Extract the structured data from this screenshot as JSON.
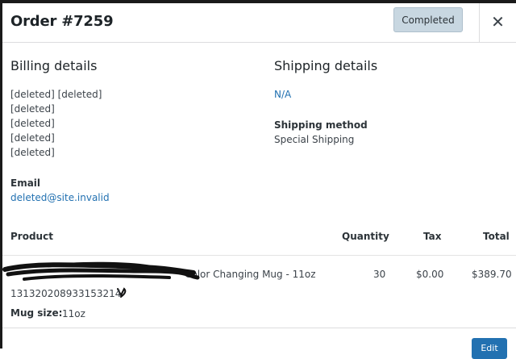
{
  "order": {
    "title": "Order #7259",
    "status": "Completed",
    "close_glyph": "✕"
  },
  "billing": {
    "title": "Billing details",
    "address_lines": [
      "[deleted] [deleted]",
      "[deleted]",
      "[deleted]",
      "[deleted]",
      "[deleted]"
    ],
    "email_label": "Email",
    "email": "deleted@site.invalid"
  },
  "shipping": {
    "title": "Shipping details",
    "address": "N/A",
    "method_label": "Shipping method",
    "method": "Special Shipping"
  },
  "table": {
    "headers": {
      "product": "Product",
      "quantity": "Quantity",
      "tax": "Tax",
      "total": "Total"
    },
    "items": [
      {
        "name_visible": "Color Changing Mug - 11oz",
        "sku": "131320208933153214",
        "meta_label": "Mug size:",
        "meta_value": "11oz",
        "quantity": "30",
        "tax": "$0.00",
        "total": "$389.70"
      }
    ]
  },
  "footer": {
    "edit_label": "Edit"
  },
  "colors": {
    "link": "#2271b1",
    "badge_bg": "#c8d7e1",
    "primary": "#2271b1"
  }
}
